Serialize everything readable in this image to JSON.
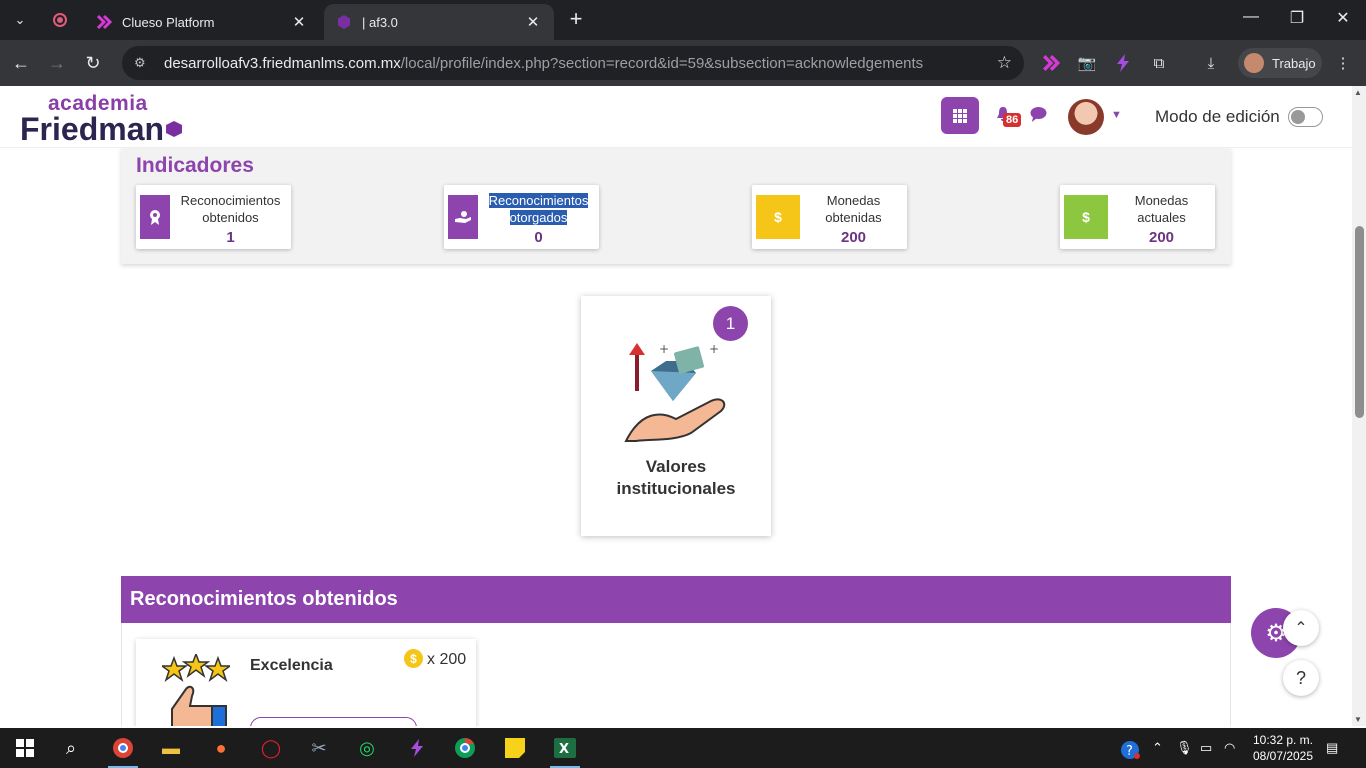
{
  "browser": {
    "tabs": [
      {
        "title": "Clueso Platform",
        "active": false
      },
      {
        "title": "| af3.0",
        "active": true
      }
    ],
    "url_host": "desarrolloafv3.friedmanlms.com.mx",
    "url_path": "/local/profile/index.php?section=record&id=59&subsection=acknowledgements",
    "profile_label": "Trabajo"
  },
  "header": {
    "logo_top": "academia",
    "logo_bottom": "Friedman",
    "notifications_count": "86",
    "edit_mode_label": "Modo de edición"
  },
  "indicators": {
    "title": "Indicadores",
    "cards": [
      {
        "label": "Reconocimientos obtenidos",
        "value": "1",
        "icon": "award-icon",
        "color": "#8e44ad"
      },
      {
        "label": "Reconocimientos otorgados",
        "value": "0",
        "icon": "hand-giving-icon",
        "color": "#8e44ad"
      },
      {
        "label": "Monedas obtenidas",
        "value": "200",
        "icon": "dollar-icon",
        "color": "#f5c518"
      },
      {
        "label": "Monedas actuales",
        "value": "200",
        "icon": "dollar-icon",
        "color": "#8dc63f"
      }
    ]
  },
  "values_card": {
    "count": "1",
    "title": "Valores institucionales"
  },
  "section": {
    "title": "Reconocimientos obtenidos",
    "items": [
      {
        "name": "Excelencia",
        "coin_symbol": "$",
        "multiplier": "x 200"
      }
    ]
  },
  "taskbar": {
    "time": "10:32 p. m.",
    "date": "08/07/2025"
  },
  "colors": {
    "brand": "#8e44ad",
    "coin_yellow": "#f5c518",
    "coin_green": "#8dc63f"
  }
}
